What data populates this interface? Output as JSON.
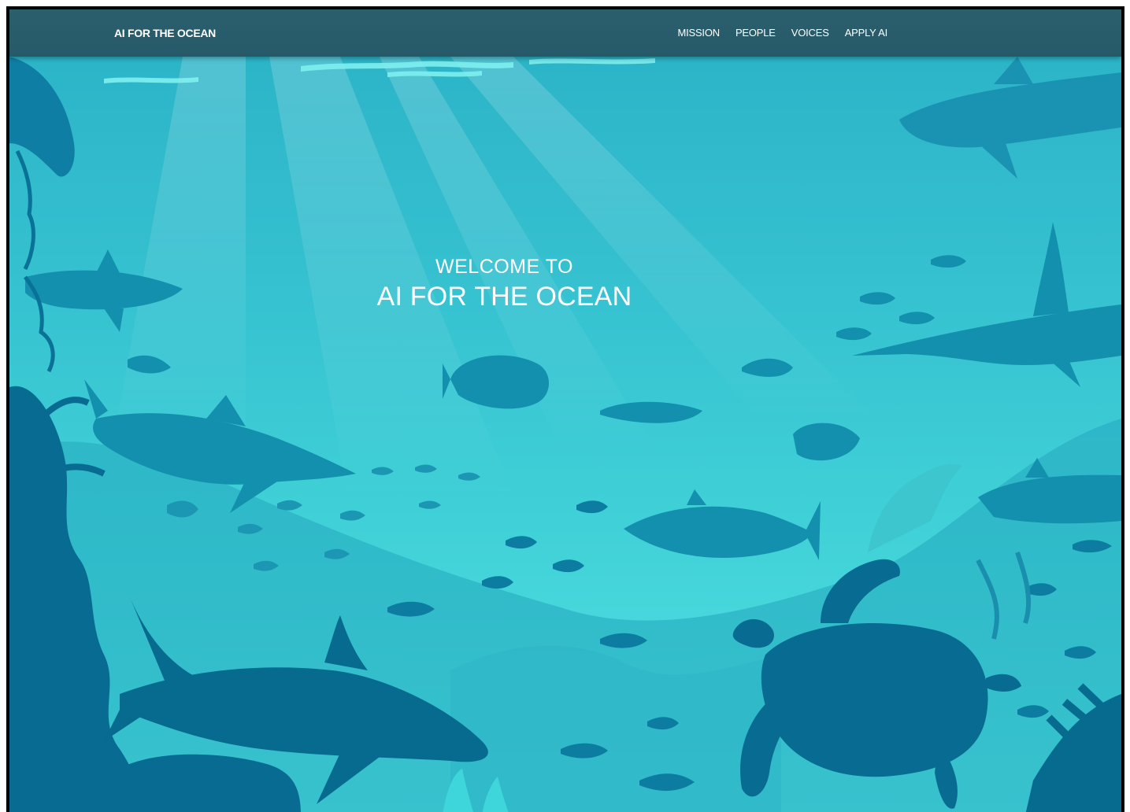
{
  "navbar": {
    "brand": "AI FOR THE OCEAN",
    "links": [
      "MISSION",
      "PEOPLE",
      "VOICES",
      "APPLY AI"
    ]
  },
  "hero": {
    "subtitle": "WELCOME TO",
    "title": "AI FOR THE OCEAN"
  },
  "colors": {
    "navbar": "#275a69",
    "water_top": "#2ab2c6",
    "water_bottom": "#52e2e2",
    "silhouette_dark": "#086b92",
    "silhouette_mid": "#1390ad",
    "silhouette_light": "#25a5bd"
  }
}
